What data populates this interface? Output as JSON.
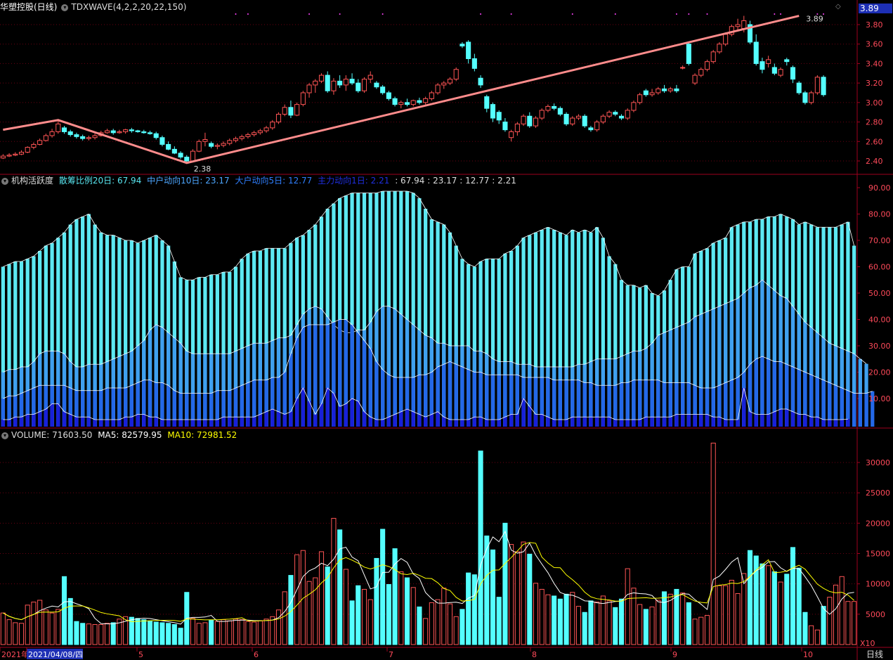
{
  "header": {
    "stock_title": "华塑控股(日线)",
    "indicator": "TDXWAVE(4,2,2,20,22,150)",
    "current_price_tag": "3.89"
  },
  "price_panel": {
    "y_ticks": [
      "3.80",
      "3.60",
      "3.40",
      "3.20",
      "3.00",
      "2.80",
      "2.60",
      "2.40"
    ],
    "y_tick_values": [
      3.8,
      3.6,
      3.4,
      3.2,
      3.0,
      2.8,
      2.6,
      2.4
    ],
    "annotations": [
      "3.89",
      "2.38"
    ],
    "candles": [
      [
        2.43,
        2.47,
        2.42,
        2.45
      ],
      [
        2.45,
        2.48,
        2.44,
        2.46
      ],
      [
        2.46,
        2.49,
        2.45,
        2.47
      ],
      [
        2.47,
        2.51,
        2.46,
        2.49
      ],
      [
        2.49,
        2.55,
        2.48,
        2.54
      ],
      [
        2.54,
        2.59,
        2.52,
        2.57
      ],
      [
        2.57,
        2.63,
        2.56,
        2.61
      ],
      [
        2.61,
        2.68,
        2.6,
        2.66
      ],
      [
        2.66,
        2.73,
        2.64,
        2.7
      ],
      [
        2.7,
        2.82,
        2.68,
        2.78
      ],
      [
        2.74,
        2.76,
        2.68,
        2.7
      ],
      [
        2.7,
        2.72,
        2.65,
        2.67
      ],
      [
        2.67,
        2.69,
        2.63,
        2.65
      ],
      [
        2.65,
        2.67,
        2.61,
        2.63
      ],
      [
        2.63,
        2.66,
        2.61,
        2.64
      ],
      [
        2.64,
        2.68,
        2.62,
        2.66
      ],
      [
        2.66,
        2.71,
        2.65,
        2.69
      ],
      [
        2.69,
        2.73,
        2.68,
        2.71
      ],
      [
        2.71,
        2.73,
        2.67,
        2.69
      ],
      [
        2.69,
        2.72,
        2.68,
        2.7
      ],
      [
        2.7,
        2.73,
        2.68,
        2.72
      ],
      [
        2.72,
        2.74,
        2.69,
        2.71
      ],
      [
        2.71,
        2.72,
        2.69,
        2.7
      ],
      [
        2.7,
        2.72,
        2.68,
        2.69
      ],
      [
        2.69,
        2.71,
        2.67,
        2.68
      ],
      [
        2.68,
        2.7,
        2.62,
        2.64
      ],
      [
        2.64,
        2.66,
        2.55,
        2.57
      ],
      [
        2.57,
        2.6,
        2.51,
        2.52
      ],
      [
        2.52,
        2.55,
        2.47,
        2.48
      ],
      [
        2.48,
        2.5,
        2.42,
        2.44
      ],
      [
        2.44,
        2.46,
        2.38,
        2.4
      ],
      [
        2.4,
        2.52,
        2.39,
        2.5
      ],
      [
        2.5,
        2.62,
        2.49,
        2.6
      ],
      [
        2.6,
        2.69,
        2.55,
        2.62
      ],
      [
        2.58,
        2.6,
        2.53,
        2.55
      ],
      [
        2.55,
        2.58,
        2.52,
        2.56
      ],
      [
        2.56,
        2.6,
        2.54,
        2.58
      ],
      [
        2.58,
        2.63,
        2.56,
        2.61
      ],
      [
        2.61,
        2.65,
        2.59,
        2.63
      ],
      [
        2.63,
        2.67,
        2.61,
        2.65
      ],
      [
        2.65,
        2.69,
        2.63,
        2.67
      ],
      [
        2.67,
        2.71,
        2.65,
        2.69
      ],
      [
        2.69,
        2.73,
        2.67,
        2.71
      ],
      [
        2.71,
        2.76,
        2.69,
        2.74
      ],
      [
        2.74,
        2.82,
        2.72,
        2.8
      ],
      [
        2.8,
        2.9,
        2.78,
        2.88
      ],
      [
        2.88,
        2.98,
        2.86,
        2.95
      ],
      [
        2.95,
        3.02,
        2.84,
        2.87
      ],
      [
        2.87,
        3.0,
        2.86,
        2.98
      ],
      [
        2.98,
        3.12,
        2.96,
        3.1
      ],
      [
        3.1,
        3.2,
        3.05,
        3.18
      ],
      [
        3.18,
        3.24,
        3.1,
        3.22
      ],
      [
        3.22,
        3.3,
        3.2,
        3.28
      ],
      [
        3.28,
        3.32,
        3.1,
        3.12
      ],
      [
        3.12,
        3.25,
        3.08,
        3.22
      ],
      [
        3.22,
        3.28,
        3.15,
        3.18
      ],
      [
        3.18,
        3.28,
        3.12,
        3.24
      ],
      [
        3.24,
        3.3,
        3.18,
        3.2
      ],
      [
        3.2,
        3.24,
        3.1,
        3.12
      ],
      [
        3.12,
        3.26,
        3.1,
        3.24
      ],
      [
        3.24,
        3.32,
        3.2,
        3.28
      ],
      [
        3.2,
        3.22,
        3.14,
        3.16
      ],
      [
        3.16,
        3.18,
        3.08,
        3.1
      ],
      [
        3.1,
        3.12,
        3.02,
        3.04
      ],
      [
        3.04,
        3.06,
        2.96,
        2.98
      ],
      [
        2.98,
        3.02,
        2.94,
        3.0
      ],
      [
        3.0,
        3.04,
        2.96,
        2.98
      ],
      [
        2.98,
        3.03,
        2.96,
        3.02
      ],
      [
        3.02,
        3.05,
        2.98,
        3.0
      ],
      [
        3.0,
        3.06,
        2.98,
        3.04
      ],
      [
        3.04,
        3.12,
        3.02,
        3.1
      ],
      [
        3.1,
        3.2,
        3.08,
        3.18
      ],
      [
        3.18,
        3.22,
        3.14,
        3.2
      ],
      [
        3.2,
        3.26,
        3.18,
        3.24
      ],
      [
        3.24,
        3.36,
        3.22,
        3.34
      ],
      [
        3.6,
        3.62,
        3.56,
        3.58
      ],
      [
        3.62,
        3.64,
        3.4,
        3.45
      ],
      [
        3.45,
        3.5,
        3.32,
        3.35
      ],
      [
        3.25,
        3.28,
        3.15,
        3.18
      ],
      [
        3.06,
        3.08,
        2.9,
        2.94
      ],
      [
        2.98,
        3.0,
        2.8,
        2.84
      ],
      [
        2.9,
        2.92,
        2.78,
        2.82
      ],
      [
        2.8,
        2.84,
        2.7,
        2.72
      ],
      [
        2.64,
        2.72,
        2.6,
        2.7
      ],
      [
        2.7,
        2.8,
        2.66,
        2.78
      ],
      [
        2.78,
        2.88,
        2.76,
        2.86
      ],
      [
        2.86,
        2.9,
        2.74,
        2.76
      ],
      [
        2.76,
        2.86,
        2.74,
        2.84
      ],
      [
        2.84,
        2.94,
        2.82,
        2.92
      ],
      [
        2.92,
        2.98,
        2.9,
        2.96
      ],
      [
        2.96,
        2.99,
        2.92,
        2.94
      ],
      [
        2.94,
        2.96,
        2.86,
        2.88
      ],
      [
        2.88,
        2.9,
        2.76,
        2.78
      ],
      [
        2.78,
        2.86,
        2.76,
        2.84
      ],
      [
        2.84,
        2.88,
        2.82,
        2.86
      ],
      [
        2.86,
        2.88,
        2.74,
        2.76
      ],
      [
        2.74,
        2.76,
        2.7,
        2.72
      ],
      [
        2.72,
        2.82,
        2.7,
        2.8
      ],
      [
        2.8,
        2.88,
        2.78,
        2.86
      ],
      [
        2.86,
        2.92,
        2.84,
        2.9
      ],
      [
        2.9,
        2.92,
        2.86,
        2.88
      ],
      [
        2.86,
        2.88,
        2.82,
        2.84
      ],
      [
        2.84,
        2.94,
        2.82,
        2.92
      ],
      [
        2.92,
        3.02,
        2.9,
        3.0
      ],
      [
        3.0,
        3.1,
        2.98,
        3.08
      ],
      [
        3.12,
        3.14,
        3.06,
        3.08
      ],
      [
        3.08,
        3.14,
        3.06,
        3.1
      ],
      [
        3.1,
        3.16,
        3.08,
        3.14
      ],
      [
        3.14,
        3.18,
        3.1,
        3.12
      ],
      [
        3.12,
        3.16,
        3.1,
        3.14
      ],
      [
        3.14,
        3.18,
        3.1,
        3.12
      ],
      [
        3.36,
        3.38,
        3.34,
        3.36
      ],
      [
        3.6,
        3.62,
        3.38,
        3.4
      ],
      [
        3.2,
        3.3,
        3.18,
        3.28
      ],
      [
        3.28,
        3.36,
        3.26,
        3.34
      ],
      [
        3.34,
        3.44,
        3.32,
        3.42
      ],
      [
        3.42,
        3.54,
        3.4,
        3.52
      ],
      [
        3.52,
        3.62,
        3.5,
        3.6
      ],
      [
        3.6,
        3.72,
        3.58,
        3.7
      ],
      [
        3.7,
        3.8,
        3.68,
        3.78
      ],
      [
        3.78,
        3.86,
        3.74,
        3.8
      ],
      [
        3.76,
        3.89,
        3.72,
        3.84
      ],
      [
        3.8,
        3.84,
        3.6,
        3.62
      ],
      [
        3.62,
        3.7,
        3.38,
        3.4
      ],
      [
        3.42,
        3.46,
        3.3,
        3.34
      ],
      [
        3.4,
        3.48,
        3.36,
        3.44
      ],
      [
        3.36,
        3.4,
        3.28,
        3.3
      ],
      [
        3.28,
        3.36,
        3.26,
        3.34
      ],
      [
        3.44,
        3.46,
        3.38,
        3.42
      ],
      [
        3.36,
        3.38,
        3.2,
        3.24
      ],
      [
        3.2,
        3.22,
        3.08,
        3.1
      ],
      [
        3.1,
        3.12,
        2.98,
        3.0
      ],
      [
        3.0,
        3.12,
        2.98,
        3.1
      ],
      [
        3.1,
        3.28,
        3.08,
        3.26
      ],
      [
        3.26,
        3.28,
        3.06,
        3.08
      ]
    ],
    "wave_points": [
      [
        0,
        2.72
      ],
      [
        9,
        2.82
      ],
      [
        30,
        2.38
      ],
      [
        130,
        3.89
      ]
    ]
  },
  "activity_panel": {
    "title": "机构活跃度",
    "legend": [
      {
        "label": "散筹比例20日: 67.94",
        "color": "#59e6f0"
      },
      {
        "label": "中户动向10日: 23.17",
        "color": "#4da6ff"
      },
      {
        "label": "大户动向5日: 12.77",
        "color": "#2f7fff"
      },
      {
        "label": "主力动向1日: 2.21",
        "color": "#1f2fe0"
      }
    ],
    "values_line": ": 67.94 : 23.17 : 12.77 : 2.21",
    "y_ticks": [
      "90.00",
      "80.00",
      "70.00",
      "60.00",
      "50.00",
      "40.00",
      "30.00",
      "20.00",
      "10.00"
    ],
    "y_tick_values": [
      90,
      80,
      70,
      60,
      50,
      40,
      30,
      20,
      10
    ],
    "series_retail20": [
      60,
      61,
      62,
      62,
      63,
      64,
      66,
      68,
      69,
      71,
      73,
      76,
      78,
      79,
      80,
      76,
      73,
      72,
      72,
      71,
      70,
      70,
      69,
      70,
      71,
      72,
      70,
      68,
      62,
      56,
      55,
      55,
      56,
      56,
      57,
      57,
      58,
      58,
      60,
      63,
      65,
      66,
      66,
      67,
      67,
      67,
      67,
      69,
      71,
      72,
      74,
      76,
      79,
      82,
      84,
      86,
      87,
      88,
      88,
      88,
      88,
      88,
      89,
      89,
      89,
      90,
      89,
      88,
      86,
      82,
      78,
      77,
      76,
      73,
      68,
      63,
      61,
      60,
      62,
      63,
      63,
      63,
      65,
      66,
      68,
      71,
      72,
      73,
      74,
      75,
      74,
      73,
      72,
      74,
      73,
      74,
      73,
      75,
      71,
      64,
      61,
      55,
      53,
      53,
      52,
      53,
      50,
      49,
      51,
      55,
      59,
      60,
      60,
      65,
      66,
      67,
      69,
      70,
      71,
      75,
      76,
      77,
      77,
      78,
      78,
      79,
      79,
      80,
      79,
      78,
      76,
      77,
      76,
      75,
      75,
      75,
      75,
      76,
      77,
      68
    ],
    "series_mid10": [
      20,
      21,
      21,
      22,
      22,
      24,
      27,
      28,
      28,
      28,
      27,
      24,
      22,
      22,
      23,
      23,
      23,
      24,
      25,
      26,
      27,
      28,
      30,
      32,
      36,
      38,
      37,
      35,
      33,
      31,
      28,
      27,
      27,
      27,
      27,
      27,
      27,
      27,
      28,
      29,
      30,
      31,
      31,
      31,
      32,
      33,
      33,
      34,
      38,
      42,
      44,
      45,
      44,
      41,
      38,
      36,
      35,
      35,
      36,
      36,
      39,
      43,
      45,
      45,
      44,
      42,
      40,
      38,
      36,
      34,
      33,
      31,
      31,
      30,
      30,
      30,
      30,
      28,
      28,
      27,
      25,
      24,
      24,
      24,
      23,
      23,
      23,
      22,
      22,
      22,
      22,
      22,
      22,
      22,
      23,
      23,
      24,
      25,
      25,
      25,
      25,
      26,
      27,
      28,
      28,
      29,
      31,
      34,
      35,
      36,
      37,
      38,
      39,
      41,
      42,
      43,
      44,
      45,
      46,
      47,
      48,
      50,
      52,
      53,
      55,
      53,
      51,
      49,
      48,
      45,
      42,
      39,
      37,
      35,
      33,
      31,
      30,
      29,
      28,
      27,
      25,
      23.17
    ],
    "series_big5": [
      10,
      11,
      11,
      12,
      13,
      14,
      15,
      15,
      15,
      15,
      15,
      14,
      13,
      13,
      13,
      13,
      13,
      14,
      14,
      14,
      14,
      15,
      16,
      17,
      17,
      16,
      16,
      15,
      13,
      12,
      12,
      12,
      12,
      12,
      12,
      13,
      13,
      13,
      14,
      15,
      16,
      17,
      17,
      17,
      18,
      18,
      20,
      27,
      33,
      37,
      38,
      38,
      38,
      38,
      39,
      40,
      40,
      38,
      35,
      32,
      29,
      24,
      21,
      19,
      18,
      18,
      18,
      18,
      19,
      19,
      20,
      22,
      23,
      24,
      23,
      22,
      21,
      20,
      20,
      19,
      19,
      19,
      19,
      19,
      19,
      18,
      18,
      18,
      18,
      18,
      17,
      17,
      17,
      17,
      17,
      16,
      16,
      15,
      15,
      15,
      15,
      16,
      16,
      17,
      17,
      17,
      17,
      17,
      16,
      16,
      16,
      16,
      16,
      15,
      14,
      14,
      14,
      15,
      16,
      17,
      18,
      20,
      23,
      25,
      26,
      25,
      24,
      24,
      23,
      22,
      21,
      20,
      19,
      18,
      17,
      16,
      15,
      14,
      13,
      12,
      12,
      12,
      12.77
    ],
    "series_main1": [
      2,
      2,
      3,
      3,
      4,
      4,
      5,
      6,
      8,
      8,
      5,
      4,
      3,
      3,
      3,
      2,
      2,
      2,
      2,
      2,
      3,
      3,
      4,
      4,
      3,
      3,
      2,
      2,
      2,
      2,
      2,
      2,
      2,
      2,
      2,
      2,
      3,
      3,
      3,
      3,
      3,
      3,
      4,
      5,
      6,
      5,
      4,
      5,
      10,
      14,
      9,
      4,
      8,
      14,
      12,
      7,
      8,
      10,
      9,
      5,
      3,
      2,
      2,
      3,
      4,
      5,
      6,
      5,
      4,
      3,
      4,
      5,
      3,
      2,
      2,
      2,
      2,
      3,
      3,
      2,
      2,
      2,
      3,
      4,
      4,
      10,
      7,
      4,
      4,
      3,
      2,
      2,
      2,
      3,
      3,
      3,
      3,
      3,
      3,
      3,
      2,
      2,
      2,
      2,
      2,
      3,
      3,
      3,
      3,
      3,
      4,
      4,
      4,
      4,
      4,
      4,
      3,
      3,
      2,
      2,
      2,
      14,
      5,
      4,
      4,
      4,
      5,
      6,
      6,
      5,
      4,
      4,
      3,
      3,
      2,
      2,
      2,
      2,
      2.21
    ]
  },
  "volume_panel": {
    "legend": [
      {
        "label": "VOLUME: 71603.50",
        "color": "#cccccc"
      },
      {
        "label": "MA5: 82579.95",
        "color": "#ffffff"
      },
      {
        "label": "MA10: 72981.52",
        "color": "#ffff00"
      }
    ],
    "y_ticks": [
      "30000",
      "25000",
      "20000",
      "15000",
      "10000",
      "5000"
    ],
    "y_tick_values": [
      30000,
      25000,
      20000,
      15000,
      10000,
      5000
    ],
    "unit_label": "X10",
    "volumes": [
      5200,
      4100,
      3600,
      3500,
      6500,
      7000,
      7300,
      5700,
      5200,
      5800,
      11200,
      7600,
      3800,
      3500,
      3400,
      3300,
      3300,
      3500,
      3600,
      4200,
      4600,
      4500,
      4300,
      4100,
      3900,
      3700,
      3600,
      3500,
      3300,
      2700,
      8600,
      4300,
      3500,
      3600,
      4000,
      3800,
      4100,
      3900,
      4200,
      4100,
      3800,
      3700,
      3900,
      4200,
      4600,
      5700,
      8700,
      11400,
      14800,
      15500,
      10400,
      11000,
      15300,
      12800,
      20800,
      18900,
      12400,
      7200,
      9700,
      9100,
      7400,
      14200,
      19000,
      9900,
      15800,
      12000,
      11000,
      9400,
      6200,
      4300,
      6900,
      7400,
      9300,
      6700,
      4600,
      5800,
      11800,
      11500,
      31900,
      17900,
      15600,
      7800,
      20000,
      16500,
      15300,
      16900,
      14900,
      10100,
      9100,
      8200,
      8000,
      7500,
      8300,
      8600,
      6300,
      5300,
      7200,
      7000,
      8000,
      7200,
      6100,
      7500,
      12500,
      9300,
      6600,
      5800,
      6200,
      7300,
      8700,
      8300,
      9100,
      8500,
      6900,
      4200,
      4500,
      4800,
      33200,
      9700,
      9700,
      10600,
      8400,
      11700,
      15500,
      14600,
      13300,
      13000,
      12000,
      10300,
      11600,
      16000,
      12600,
      5300,
      3100,
      2400,
      6300,
      7800,
      9800,
      11200,
      7100,
      7100
    ]
  },
  "x_axis": {
    "labels": [
      "2021年",
      "2021/04/08/四",
      "5",
      "6",
      "7",
      "8",
      "9",
      "10"
    ],
    "period_label": "日线"
  }
}
